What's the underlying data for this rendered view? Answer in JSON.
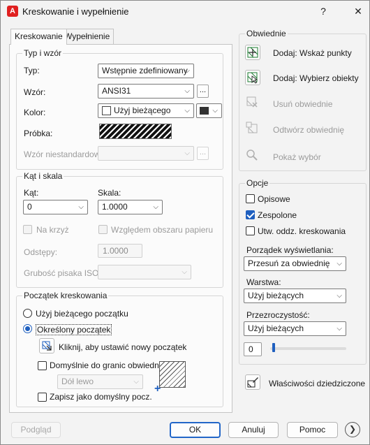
{
  "window": {
    "title": "Kreskowanie i wypełnienie",
    "help": "?",
    "close": "✕"
  },
  "tabs": [
    {
      "label": "Kreskowanie"
    },
    {
      "label": "Wypełnienie"
    }
  ],
  "typ_wzor": {
    "title": "Typ i wzór",
    "typ_label": "Typ:",
    "typ_value": "Wstępnie zdefiniowany",
    "wzor_label": "Wzór:",
    "wzor_value": "ANSI31",
    "wzor_more": "...",
    "kolor_label": "Kolor:",
    "kolor_value": "Użyj bieżącego",
    "probka_label": "Próbka:",
    "custom_label": "Wzór niestandardowy:",
    "custom_more": "..."
  },
  "kat_skala": {
    "title": "Kąt i skala",
    "kat_label": "Kąt:",
    "kat_value": "0",
    "skala_label": "Skala:",
    "skala_value": "1.0000",
    "na_krzyz_label": "Na krzyż",
    "papier_label": "Względem obszaru papieru",
    "odstepy_label": "Odstępy:",
    "odstepy_value": "1.0000",
    "grubosc_label": "Grubość pisaka ISO:"
  },
  "poczatek": {
    "title": "Początek kreskowania",
    "biezacy_label": "Użyj bieżącego początku",
    "okreslony_label": "Określony początek",
    "kliknij_label": "Kliknij, aby ustawić nowy początek",
    "domyslnie_label": "Domyślnie do granic obwiedni",
    "pozycja_value": "Dół lewo",
    "zapisz_label": "Zapisz jako domyślny pocz."
  },
  "obwiednie": {
    "title": "Obwiednie",
    "wskaz_label": "Dodaj: Wskaż punkty",
    "wybierz_label": "Dodaj: Wybierz obiekty",
    "usun_label": "Usuń obwiednie",
    "odtworz_label": "Odtwórz obwiednię",
    "pokaz_label": "Pokaż wybór"
  },
  "opcje": {
    "title": "Opcje",
    "opisowe_label": "Opisowe",
    "zespolone_label": "Zespolone",
    "utworz_label": "Utw. oddz. kreskowania",
    "porzadek_label": "Porządek wyświetlania:",
    "porzadek_value": "Przesuń za obwiednię",
    "warstwa_label": "Warstwa:",
    "warstwa_value": "Użyj bieżących",
    "przezroczystosc_label": "Przezroczystość:",
    "przezroczystosc_value": "Użyj bieżących",
    "slider_value": "0"
  },
  "wlasciwosci_label": "Właściwości dziedziczone",
  "footer": {
    "podglad": "Podgląd",
    "ok": "OK",
    "anuluj": "Anuluj",
    "pomoc": "Pomoc"
  }
}
